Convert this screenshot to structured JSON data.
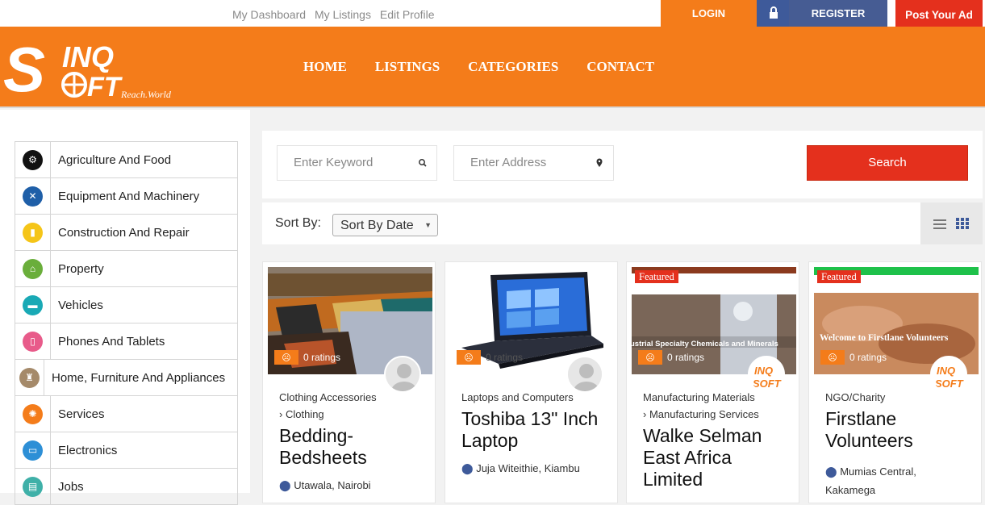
{
  "topbar": {
    "links": [
      "My Dashboard",
      "My Listings",
      "Edit Profile"
    ],
    "login": "LOGIN",
    "register": "REGISTER",
    "post_ad": "Post Your Ad"
  },
  "brand": {
    "tagline": "Reach.World"
  },
  "nav": [
    "HOME",
    "LISTINGS",
    "CATEGORIES",
    "CONTACT"
  ],
  "categories": [
    {
      "label": "Agriculture And Food",
      "icon": "tractor-icon",
      "color": "#111111",
      "glyph": "⚙"
    },
    {
      "label": "Equipment And Machinery",
      "icon": "tools-icon",
      "color": "#1f5fa8",
      "glyph": "✕"
    },
    {
      "label": "Construction And Repair",
      "icon": "crane-icon",
      "color": "#f5c518",
      "glyph": "▮"
    },
    {
      "label": "Property",
      "icon": "home-icon",
      "color": "#6aae3b",
      "glyph": "⌂"
    },
    {
      "label": "Vehicles",
      "icon": "car-icon",
      "color": "#19a9b5",
      "glyph": "▬"
    },
    {
      "label": "Phones And Tablets",
      "icon": "phone-icon",
      "color": "#e85b8a",
      "glyph": "▯"
    },
    {
      "label": "Home, Furniture And Appliances",
      "icon": "furniture-icon",
      "color": "#a58a6a",
      "glyph": "♜"
    },
    {
      "label": "Services",
      "icon": "services-gear-icon",
      "color": "#f47c1a",
      "glyph": "✺"
    },
    {
      "label": "Electronics",
      "icon": "monitor-icon",
      "color": "#2d8fd6",
      "glyph": "▭"
    },
    {
      "label": "Jobs",
      "icon": "briefcase-icon",
      "color": "#3fb0a8",
      "glyph": "▤"
    }
  ],
  "search": {
    "keyword_placeholder": "Enter Keyword",
    "address_placeholder": "Enter Address",
    "button": "Search"
  },
  "sort": {
    "label": "Sort By:",
    "selected": "Sort By Date"
  },
  "listings": [
    {
      "category": "Clothing Accessories",
      "subcategory": "Clothing",
      "title": "Bedding-Bedsheets",
      "location": "Utawala, Nairobi",
      "ratings": "0 ratings",
      "featured": "",
      "image": "bedsheets-photo"
    },
    {
      "category": "Laptops and Computers",
      "subcategory": "",
      "title": "Toshiba 13\" Inch Laptop",
      "location": "Juja Witeithie, Kiambu",
      "ratings": "0 ratings",
      "featured": "",
      "image": "laptop-photo"
    },
    {
      "category": "Manufacturing Materials",
      "subcategory": "Manufacturing Services",
      "title": "Walke Selman East Africa Limited",
      "location": "",
      "ratings": "0 ratings",
      "featured": "Featured",
      "image": "chemicals-photo",
      "image_text": "ustrial Specialty Chemicals and Minerals"
    },
    {
      "category": "NGO/Charity",
      "subcategory": "",
      "title": "Firstlane Volunteers",
      "location": "Mumias Central, Kakamega",
      "ratings": "0 ratings",
      "featured": "Featured",
      "image": "volunteers-photo",
      "image_text": "Welcome to Firstlane Volunteers"
    }
  ]
}
